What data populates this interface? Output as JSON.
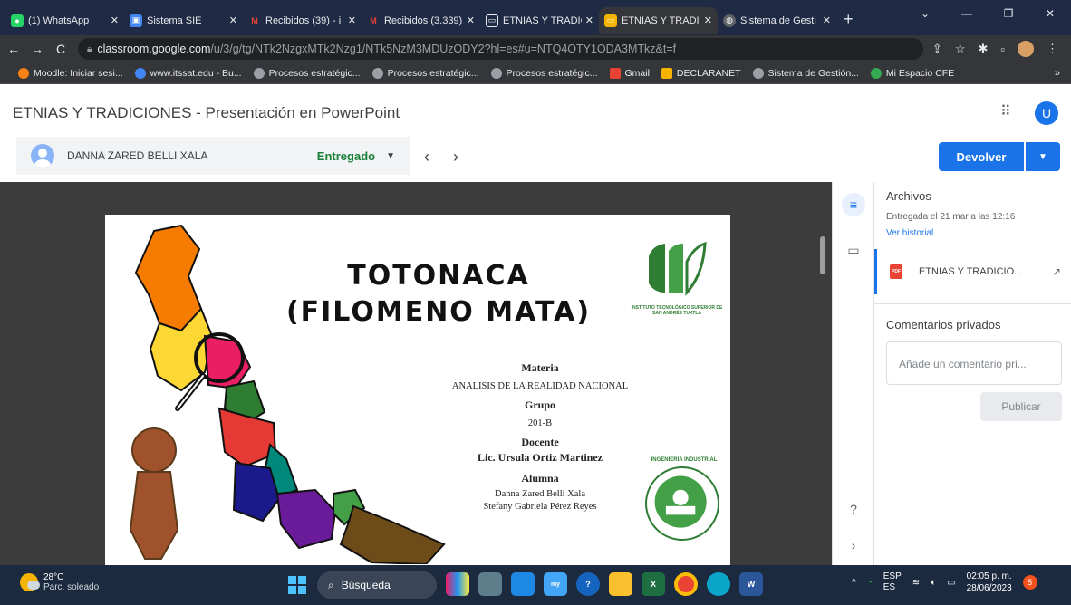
{
  "browser": {
    "tabs": [
      {
        "label": "(1) WhatsApp",
        "color": "#25d366",
        "icon": "whatsapp-icon"
      },
      {
        "label": "Sistema SIE",
        "color": "#4285f4",
        "icon": "sie-icon"
      },
      {
        "label": "Recibidos (39) - i",
        "color": "#ea4335",
        "icon": "gmail-icon"
      },
      {
        "label": "Recibidos (3.339)",
        "color": "#ea4335",
        "icon": "gmail-icon"
      },
      {
        "label": "ETNIAS Y TRADIC",
        "color": "#5f6368",
        "icon": "classroom-icon"
      },
      {
        "label": "ETNIAS Y TRADIC",
        "color": "#f4b400",
        "icon": "classroom-icon"
      },
      {
        "label": "Sistema de Gesti",
        "color": "#5f6368",
        "icon": "web-icon"
      }
    ],
    "url_host": "classroom.google.com",
    "url_path": "/u/3/g/tg/NTk2NzgxMTk2Nzg1/NTk5NzM3MDUzODY2?hl=es#u=NTQ4OTY1ODA3MTkz&t=f",
    "bookmarks": [
      {
        "label": "Moodle: Iniciar sesi...",
        "color": "#f98012"
      },
      {
        "label": "www.itssat.edu - Bu...",
        "color": "#4285f4"
      },
      {
        "label": "Procesos estratégic...",
        "color": "#9aa0a6"
      },
      {
        "label": "Procesos estratégic...",
        "color": "#9aa0a6"
      },
      {
        "label": "Procesos estratégic...",
        "color": "#9aa0a6"
      },
      {
        "label": "Gmail",
        "color": "#ea4335"
      },
      {
        "label": "DECLARANET",
        "color": "#f4b400"
      },
      {
        "label": "Sistema de Gestión...",
        "color": "#9aa0a6"
      },
      {
        "label": "Mi Espacio CFE",
        "color": "#34a853"
      }
    ]
  },
  "app": {
    "title": "ETNIAS Y TRADICIONES - Presentación en PowerPoint",
    "avatar_letter": "U",
    "student_name": "DANNA ZARED BELLI XALA",
    "status": "Entregado",
    "return_button": "Devolver"
  },
  "slide": {
    "title": "TOTONACA (FILOMENO MATA)",
    "school_name": "INSTITUTO TECNOLÓGICO SUPERIOR DE SAN ANDRÉS TUXTLA",
    "materia_label": "Materia",
    "materia": "ANALISIS DE LA REALIDAD NACIONAL",
    "grupo_label": "Grupo",
    "grupo": "201-B",
    "docente_label": "Docente",
    "docente": "Lic. Ursula Ortiz Martinez",
    "alumna_label": "Alumna",
    "alumna_1": "Danna Zared Belli Xala",
    "alumna_2": "Stefany Gabriela Pérez Reyes",
    "logo2_text": "INGENIERÍA INDUSTRIAL"
  },
  "panel": {
    "files_heading": "Archivos",
    "submitted": "Entregada el 21 mar a las 12:16",
    "history_link": "Ver historial",
    "file_name": "ETNIAS Y TRADICIO...",
    "comments_heading": "Comentarios privados",
    "comment_placeholder": "Añade un comentario pri...",
    "publish_button": "Publicar"
  },
  "taskbar": {
    "temp": "28°C",
    "weather": "Parc. soleado",
    "search": "Búsqueda",
    "lang1": "ESP",
    "lang2": "ES",
    "time": "02:05 p. m.",
    "date": "28/06/2023",
    "notifications": "5"
  }
}
